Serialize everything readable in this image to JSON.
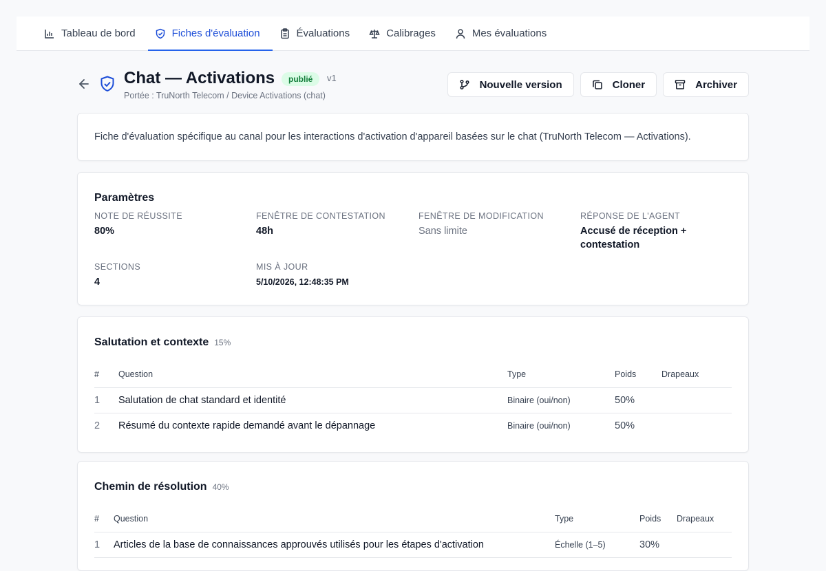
{
  "nav": {
    "tabs": [
      {
        "label": "Tableau de bord",
        "icon": "bar-chart-icon",
        "active": false
      },
      {
        "label": "Fiches d'évaluation",
        "icon": "shield-check-icon",
        "active": true
      },
      {
        "label": "Évaluations",
        "icon": "clipboard-icon",
        "active": false
      },
      {
        "label": "Calibrages",
        "icon": "scale-icon",
        "active": false
      },
      {
        "label": "Mes évaluations",
        "icon": "user-icon",
        "active": false
      }
    ]
  },
  "header": {
    "title": "Chat — Activations",
    "status_badge": "publié",
    "version": "v1",
    "scope": "Portée : TruNorth Telecom / Device Activations (chat)",
    "actions": {
      "new_version": "Nouvelle version",
      "clone": "Cloner",
      "archive": "Archiver"
    }
  },
  "description": "Fiche d'évaluation spécifique au canal pour les interactions d'activation d'appareil basées sur le chat (TruNorth Telecom — Activations).",
  "parameters": {
    "heading": "Paramètres",
    "passing_score": {
      "label": "Note de réussite",
      "value": "80%"
    },
    "dispute_window": {
      "label": "Fenêtre de contestation",
      "value": "48h"
    },
    "edit_window": {
      "label": "Fenêtre de modification",
      "value": "Sans limite"
    },
    "agent_response": {
      "label": "Réponse de l'agent",
      "value": "Accusé de réception + contestation"
    },
    "sections": {
      "label": "Sections",
      "value": "4"
    },
    "updated": {
      "label": "Mis à jour",
      "value": "5/10/2026, 12:48:35 PM"
    }
  },
  "table_headers": {
    "num": "#",
    "question": "Question",
    "type": "Type",
    "weight": "Poids",
    "flags": "Drapeaux"
  },
  "sections": [
    {
      "name": "Salutation et contexte",
      "weight": "15%",
      "questions": [
        {
          "num": "1",
          "question": "Salutation de chat standard et identité",
          "type": "Binaire (oui/non)",
          "weight": "50%",
          "flags": ""
        },
        {
          "num": "2",
          "question": "Résumé du contexte rapide demandé avant le dépannage",
          "type": "Binaire (oui/non)",
          "weight": "50%",
          "flags": ""
        }
      ]
    },
    {
      "name": "Chemin de résolution",
      "weight": "40%",
      "questions": [
        {
          "num": "1",
          "question": "Articles de la base de connaissances approuvés utilisés pour les étapes d'activation",
          "type": "Échelle (1–5)",
          "weight": "30%",
          "flags": ""
        }
      ]
    }
  ],
  "colors": {
    "accent": "#2563eb",
    "badge_bg": "#dcfce7",
    "badge_text": "#15803d"
  }
}
